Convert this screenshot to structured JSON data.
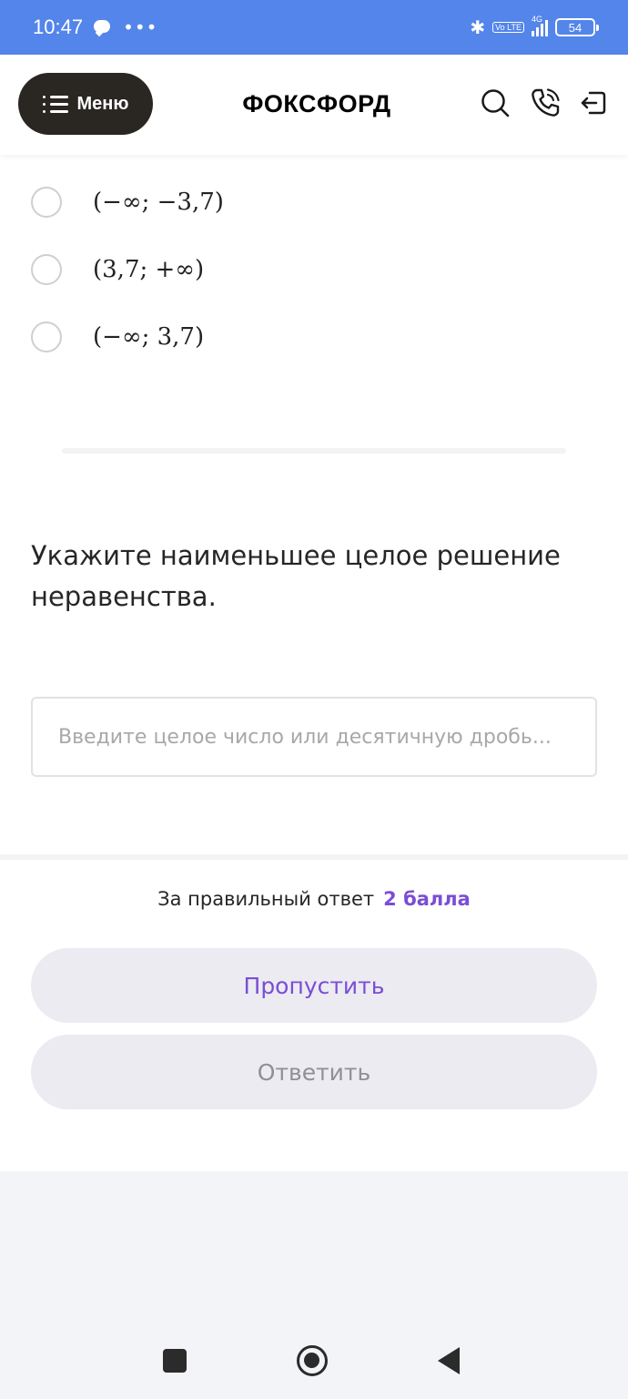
{
  "status_bar": {
    "time": "10:47",
    "dots": "•••",
    "volte": "Vo LTE",
    "network": "4G",
    "battery": "54"
  },
  "header": {
    "menu_label": "Меню",
    "logo_text": "ФОКСФОРД",
    "icons": [
      "menu-icon",
      "search-icon",
      "phone-icon",
      "logout-icon"
    ]
  },
  "options": [
    {
      "label": "(−∞; −3,7)",
      "selected": false
    },
    {
      "label": "(3,7; +∞)",
      "selected": false
    },
    {
      "label": "(−∞; 3,7)",
      "selected": false
    }
  ],
  "question": {
    "text": "Укажите наименьшее целое решение неравенства."
  },
  "answer": {
    "value": "",
    "placeholder": "Введите целое число или десятичную дробь..."
  },
  "footer": {
    "points_label": "За правильный ответ",
    "points_value": "2 балла",
    "skip_label": "Пропустить",
    "answer_label": "Ответить"
  },
  "colors": {
    "status_bar": "#5385ea",
    "accent": "#7b4dd6",
    "menu_button": "#2a2622",
    "button_bg": "#ebebf1"
  }
}
